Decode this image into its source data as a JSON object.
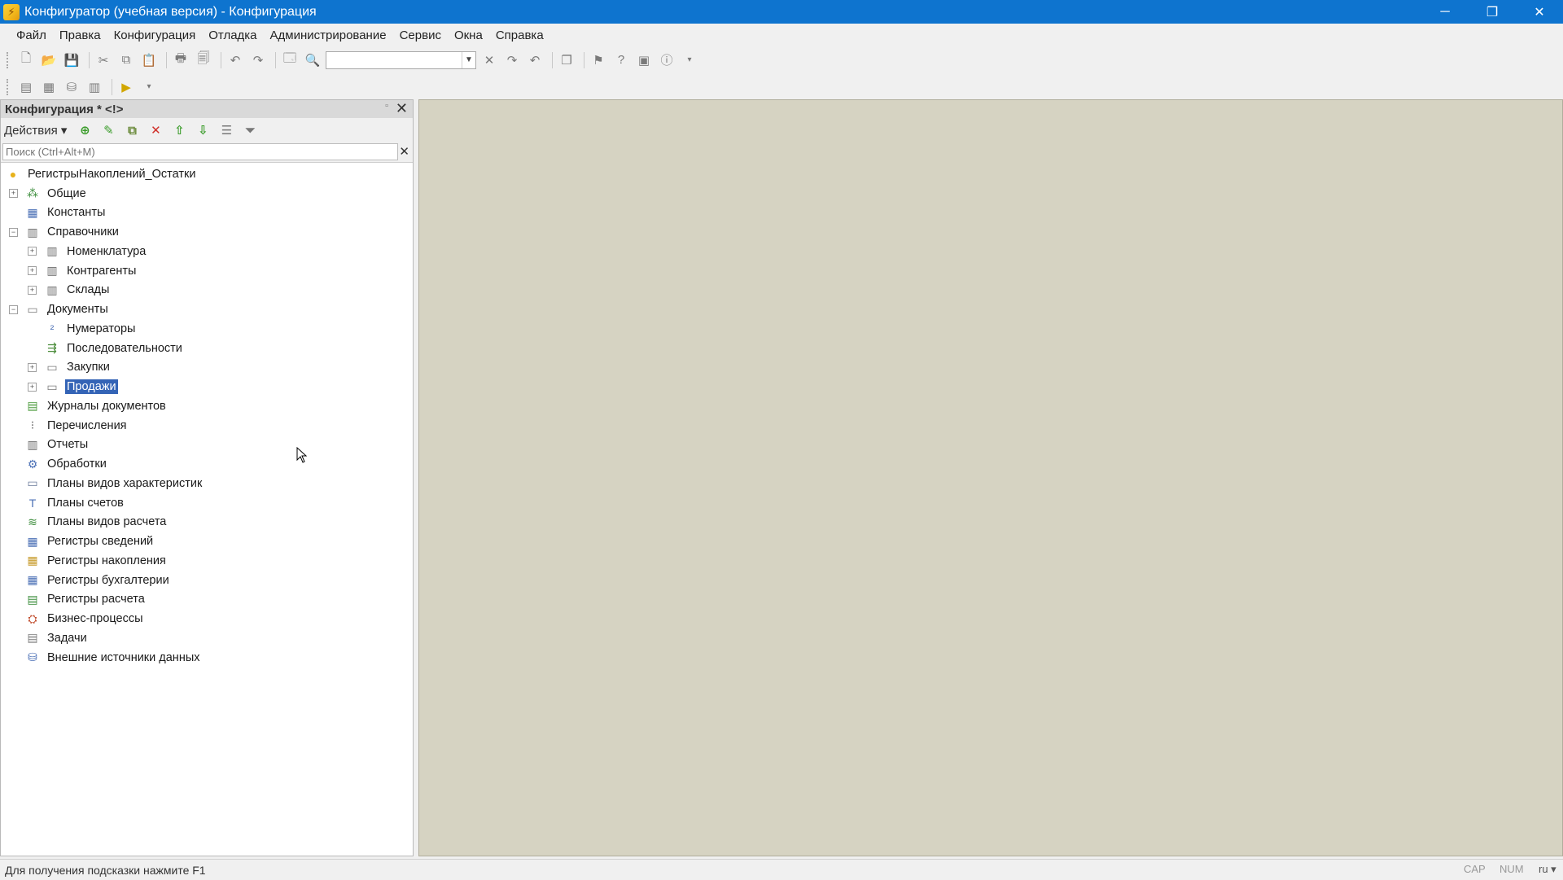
{
  "titlebar": {
    "title": "Конфигуратор (учебная версия) - Конфигурация",
    "minimize": "─",
    "restore": "❐",
    "close": "✕"
  },
  "menu": [
    "Файл",
    "Правка",
    "Конфигурация",
    "Отладка",
    "Администрирование",
    "Сервис",
    "Окна",
    "Справка"
  ],
  "panel": {
    "title": "Конфигурация * <!>",
    "actions_label": "Действия ▾",
    "search_placeholder": "Поиск (Ctrl+Alt+M)"
  },
  "tree": [
    {
      "label": "РегистрыНакоплений_Остатки",
      "level": 0,
      "icon": "config-root-icon",
      "expander": ""
    },
    {
      "label": "Общие",
      "level": 1,
      "icon": "common-icon",
      "expander": "+"
    },
    {
      "label": "Константы",
      "level": 1,
      "icon": "constants-icon",
      "expander": ""
    },
    {
      "label": "Справочники",
      "level": 1,
      "icon": "catalogs-icon",
      "expander": "−"
    },
    {
      "label": "Номенклатура",
      "level": 2,
      "icon": "catalog-icon",
      "expander": "+"
    },
    {
      "label": "Контрагенты",
      "level": 2,
      "icon": "catalog-icon",
      "expander": "+"
    },
    {
      "label": "Склады",
      "level": 2,
      "icon": "catalog-icon",
      "expander": "+"
    },
    {
      "label": "Документы",
      "level": 1,
      "icon": "documents-icon",
      "expander": "−"
    },
    {
      "label": "Нумераторы",
      "level": 2,
      "icon": "numerators-icon",
      "expander": ""
    },
    {
      "label": "Последовательности",
      "level": 2,
      "icon": "sequences-icon",
      "expander": ""
    },
    {
      "label": "Закупки",
      "level": 2,
      "icon": "document-icon",
      "expander": "+"
    },
    {
      "label": "Продажи",
      "level": 2,
      "icon": "document-icon",
      "expander": "+",
      "selected": true
    },
    {
      "label": "Журналы документов",
      "level": 1,
      "icon": "journals-icon",
      "expander": ""
    },
    {
      "label": "Перечисления",
      "level": 1,
      "icon": "enums-icon",
      "expander": ""
    },
    {
      "label": "Отчеты",
      "level": 1,
      "icon": "reports-icon",
      "expander": ""
    },
    {
      "label": "Обработки",
      "level": 1,
      "icon": "processing-icon",
      "expander": ""
    },
    {
      "label": "Планы видов характеристик",
      "level": 1,
      "icon": "chart-of-characteristics-icon",
      "expander": ""
    },
    {
      "label": "Планы счетов",
      "level": 1,
      "icon": "chart-of-accounts-icon",
      "expander": ""
    },
    {
      "label": "Планы видов расчета",
      "level": 1,
      "icon": "chart-of-calculation-icon",
      "expander": ""
    },
    {
      "label": "Регистры сведений",
      "level": 1,
      "icon": "info-registers-icon",
      "expander": ""
    },
    {
      "label": "Регистры накопления",
      "level": 1,
      "icon": "accumulation-registers-icon",
      "expander": ""
    },
    {
      "label": "Регистры бухгалтерии",
      "level": 1,
      "icon": "accounting-registers-icon",
      "expander": ""
    },
    {
      "label": "Регистры расчета",
      "level": 1,
      "icon": "calculation-registers-icon",
      "expander": ""
    },
    {
      "label": "Бизнес-процессы",
      "level": 1,
      "icon": "business-processes-icon",
      "expander": ""
    },
    {
      "label": "Задачи",
      "level": 1,
      "icon": "tasks-icon",
      "expander": ""
    },
    {
      "label": "Внешние источники данных",
      "level": 1,
      "icon": "external-sources-icon",
      "expander": ""
    }
  ],
  "statusbar": {
    "hint": "Для получения подсказки нажмите F1",
    "cap": "CAP",
    "num": "NUM",
    "lang": "ru ▾"
  },
  "colors": {
    "titlebar": "#0e74cf",
    "workspace": "#d6d3c2",
    "selection": "#3464b6"
  }
}
